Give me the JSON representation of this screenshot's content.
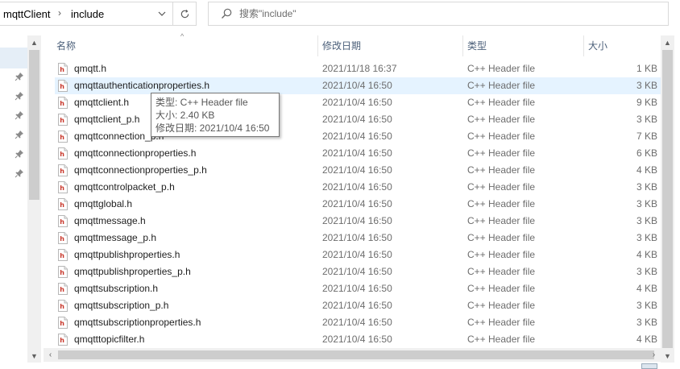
{
  "breadcrumb": {
    "parent": "mqttClient",
    "current": "include"
  },
  "search": {
    "placeholder": "搜索\"include\""
  },
  "columns": {
    "name": "名称",
    "date": "修改日期",
    "type": "类型",
    "size": "大小"
  },
  "files": [
    {
      "name": "qmqtt.h",
      "date": "2021/11/18 16:37",
      "type": "C++ Header file",
      "size": "1 KB"
    },
    {
      "name": "qmqttauthenticationproperties.h",
      "date": "2021/10/4 16:50",
      "type": "C++ Header file",
      "size": "3 KB"
    },
    {
      "name": "qmqttclient.h",
      "date": "2021/10/4 16:50",
      "type": "C++ Header file",
      "size": "9 KB"
    },
    {
      "name": "qmqttclient_p.h",
      "date": "2021/10/4 16:50",
      "type": "C++ Header file",
      "size": "3 KB"
    },
    {
      "name": "qmqttconnection_p.h",
      "date": "2021/10/4 16:50",
      "type": "C++ Header file",
      "size": "7 KB"
    },
    {
      "name": "qmqttconnectionproperties.h",
      "date": "2021/10/4 16:50",
      "type": "C++ Header file",
      "size": "6 KB"
    },
    {
      "name": "qmqttconnectionproperties_p.h",
      "date": "2021/10/4 16:50",
      "type": "C++ Header file",
      "size": "4 KB"
    },
    {
      "name": "qmqttcontrolpacket_p.h",
      "date": "2021/10/4 16:50",
      "type": "C++ Header file",
      "size": "3 KB"
    },
    {
      "name": "qmqttglobal.h",
      "date": "2021/10/4 16:50",
      "type": "C++ Header file",
      "size": "3 KB"
    },
    {
      "name": "qmqttmessage.h",
      "date": "2021/10/4 16:50",
      "type": "C++ Header file",
      "size": "3 KB"
    },
    {
      "name": "qmqttmessage_p.h",
      "date": "2021/10/4 16:50",
      "type": "C++ Header file",
      "size": "3 KB"
    },
    {
      "name": "qmqttpublishproperties.h",
      "date": "2021/10/4 16:50",
      "type": "C++ Header file",
      "size": "4 KB"
    },
    {
      "name": "qmqttpublishproperties_p.h",
      "date": "2021/10/4 16:50",
      "type": "C++ Header file",
      "size": "3 KB"
    },
    {
      "name": "qmqttsubscription.h",
      "date": "2021/10/4 16:50",
      "type": "C++ Header file",
      "size": "4 KB"
    },
    {
      "name": "qmqttsubscription_p.h",
      "date": "2021/10/4 16:50",
      "type": "C++ Header file",
      "size": "3 KB"
    },
    {
      "name": "qmqttsubscriptionproperties.h",
      "date": "2021/10/4 16:50",
      "type": "C++ Header file",
      "size": "3 KB"
    },
    {
      "name": "qmqtttopicfilter.h",
      "date": "2021/10/4 16:50",
      "type": "C++ Header file",
      "size": "4 KB"
    }
  ],
  "tooltip": {
    "type": "类型: C++ Header file",
    "size": "大小: 2.40 KB",
    "modified": "修改日期: 2021/10/4 16:50"
  },
  "colors": {
    "hover_row": "#e5f3ff",
    "header_text": "#4c607a",
    "file_icon_red": "#c8382c"
  }
}
